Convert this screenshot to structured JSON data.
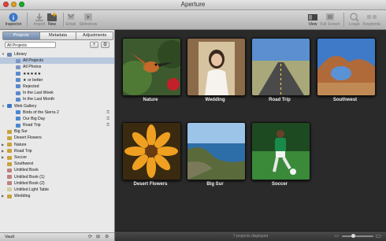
{
  "window": {
    "title": "Aperture"
  },
  "toolbar": {
    "left": [
      {
        "name": "inspector",
        "label": "Inspector",
        "icon": "info-icon",
        "enabled": true
      },
      {
        "name": "import",
        "label": "Import",
        "icon": "import-icon",
        "enabled": false
      },
      {
        "name": "new",
        "label": "New",
        "icon": "new-folder-icon",
        "enabled": true
      },
      {
        "name": "email",
        "label": "Email",
        "icon": "email-icon",
        "enabled": false
      },
      {
        "name": "slideshow",
        "label": "Slideshow",
        "icon": "slideshow-icon",
        "enabled": false
      }
    ],
    "right": [
      {
        "name": "view",
        "label": "View",
        "icon": "view-icon",
        "enabled": true
      },
      {
        "name": "full-screen",
        "label": "Full Screen",
        "icon": "full-screen-icon",
        "enabled": false
      },
      {
        "name": "loupe",
        "label": "Loupe",
        "icon": "loupe-icon",
        "enabled": false
      },
      {
        "name": "keywords",
        "label": "Keywords",
        "icon": "keywords-icon",
        "enabled": false
      }
    ]
  },
  "sidebar": {
    "tabs": [
      "Projects",
      "Metadata",
      "Adjustments"
    ],
    "active_tab": 0,
    "filter": "All Projects",
    "tree": [
      {
        "label": "Library",
        "indent": 0,
        "icon": "library-icon",
        "expanded": true
      },
      {
        "label": "All Projects",
        "indent": 1,
        "icon": "projects-icon",
        "selected": true
      },
      {
        "label": "All Photos",
        "indent": 1,
        "icon": "photos-icon"
      },
      {
        "label": "★★★★★",
        "indent": 1,
        "icon": "smart-album-icon"
      },
      {
        "label": "★ or better",
        "indent": 1,
        "icon": "smart-album-icon"
      },
      {
        "label": "Rejected",
        "indent": 1,
        "icon": "smart-album-icon"
      },
      {
        "label": "In the Last Week",
        "indent": 1,
        "icon": "smart-album-icon"
      },
      {
        "label": "In the Last Month",
        "indent": 1,
        "icon": "smart-album-icon"
      },
      {
        "label": "Web Gallery",
        "indent": 0,
        "icon": "web-gallery-icon",
        "expanded": true
      },
      {
        "label": "Birds of the Sierra 2",
        "indent": 1,
        "icon": "web-page-icon",
        "locked": true
      },
      {
        "label": "Our Big Day",
        "indent": 1,
        "icon": "web-page-icon",
        "locked": true
      },
      {
        "label": "Road Trip",
        "indent": 1,
        "icon": "web-page-icon",
        "locked": true
      },
      {
        "label": "Big Sur",
        "indent": 0,
        "icon": "project-icon"
      },
      {
        "label": "Desert Flowers",
        "indent": 0,
        "icon": "project-icon"
      },
      {
        "label": "Nature",
        "indent": 0,
        "icon": "project-icon",
        "collapsed": true
      },
      {
        "label": "Road Trip",
        "indent": 0,
        "icon": "project-icon",
        "collapsed": true
      },
      {
        "label": "Soccer",
        "indent": 0,
        "icon": "project-icon",
        "collapsed": true
      },
      {
        "label": "Southwest",
        "indent": 0,
        "icon": "project-icon"
      },
      {
        "label": "Untitled Book",
        "indent": 0,
        "icon": "book-icon"
      },
      {
        "label": "Untitled Book (1)",
        "indent": 0,
        "icon": "book-icon"
      },
      {
        "label": "Untitled Book (2)",
        "indent": 0,
        "icon": "book-icon"
      },
      {
        "label": "Untitled Light Table",
        "indent": 0,
        "icon": "light-table-icon"
      },
      {
        "label": "Wedding",
        "indent": 0,
        "icon": "project-icon",
        "collapsed": true
      }
    ],
    "vault_label": "Vault"
  },
  "projects": [
    {
      "name": "Nature",
      "icon": "hummingbird-photo"
    },
    {
      "name": "Wedding",
      "icon": "bride-photo"
    },
    {
      "name": "Road Trip",
      "icon": "highway-photo"
    },
    {
      "name": "Southwest",
      "icon": "arch-photo"
    },
    {
      "name": "Desert Flowers",
      "icon": "flower-photo"
    },
    {
      "name": "Big Sur",
      "icon": "coastline-photo"
    },
    {
      "name": "Soccer",
      "icon": "soccer-player-photo"
    }
  ],
  "status": {
    "text": "7 projects displayed"
  },
  "colors": {
    "selection": "#b8c8dd",
    "browser_bg": "#2a2a2a",
    "accent": "#6f88aa"
  }
}
